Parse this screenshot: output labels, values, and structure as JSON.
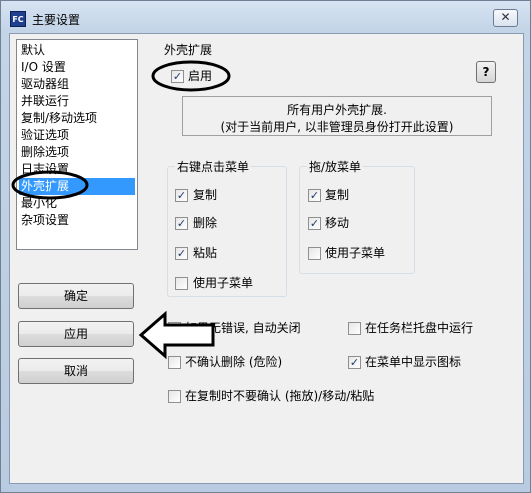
{
  "window": {
    "title": "主要设置",
    "app_icon_text": "FC",
    "close_label": "✕"
  },
  "sidebar": {
    "items": [
      {
        "label": "默认",
        "selected": false
      },
      {
        "label": "I/O 设置",
        "selected": false
      },
      {
        "label": "驱动器组",
        "selected": false
      },
      {
        "label": "并联运行",
        "selected": false
      },
      {
        "label": "复制/移动选项",
        "selected": false
      },
      {
        "label": "验证选项",
        "selected": false
      },
      {
        "label": "删除选项",
        "selected": false
      },
      {
        "label": "日志设置",
        "selected": false
      },
      {
        "label": "外壳扩展",
        "selected": true
      },
      {
        "label": "最小化",
        "selected": false
      },
      {
        "label": "杂项设置",
        "selected": false
      }
    ]
  },
  "buttons": {
    "ok": "确定",
    "apply": "应用",
    "cancel": "取消",
    "help": "?"
  },
  "shell_ext": {
    "group_title": "外壳扩展",
    "enable_label": "启用",
    "enable_checked": true,
    "info_line1": "所有用户外壳扩展.",
    "info_line2": "(对于当前用户, 以非管理员身份打开此设置)"
  },
  "right_click_menu": {
    "title": "右键点击菜单",
    "copy": {
      "label": "复制",
      "checked": true
    },
    "delete": {
      "label": "删除",
      "checked": true
    },
    "paste": {
      "label": "粘贴",
      "checked": true
    },
    "submenu": {
      "label": "使用子菜单",
      "checked": false
    }
  },
  "drag_drop_menu": {
    "title": "拖/放菜单",
    "copy": {
      "label": "复制",
      "checked": true
    },
    "move": {
      "label": "移动",
      "checked": true
    },
    "submenu": {
      "label": "使用子菜单",
      "checked": false
    }
  },
  "options": {
    "auto_close": {
      "label": "如果无错误, 自动关闭",
      "checked": true
    },
    "tray": {
      "label": "在任务栏托盘中运行",
      "checked": false
    },
    "no_confirm_delete": {
      "label": "不确认删除 (危险)",
      "checked": false
    },
    "show_icon": {
      "label": "在菜单中显示图标",
      "checked": true
    },
    "no_confirm_copy": {
      "label": "在复制时不要确认 (拖放)/移动/粘贴",
      "checked": false
    }
  },
  "icons": {
    "check": "✓"
  }
}
